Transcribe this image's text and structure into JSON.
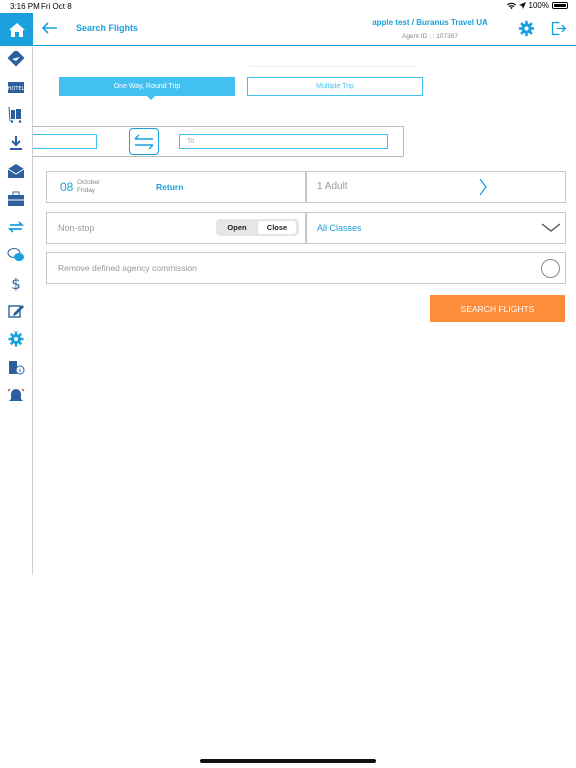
{
  "status_bar": {
    "time": "3:16 PM",
    "date": "Fri Oct 8",
    "battery": "100%"
  },
  "header": {
    "title": "Search Flights",
    "agent_name": "apple test / Buranus Travel UA",
    "agent_id": "Agent ID : : 107387"
  },
  "trip_types": {
    "one_way_round": "One Way, Round Trip",
    "multiple": "Multiple Trip",
    "selected": "One Way, Round Trip"
  },
  "route": {
    "from_value": "",
    "to_placeholder": "To"
  },
  "date": {
    "day": "08",
    "month": "October",
    "weekday": "Friday",
    "return_label": "Return"
  },
  "passengers": {
    "label": "1 Adult"
  },
  "stops": {
    "label": "Non-stop",
    "open_label": "Open",
    "close_label": "Close",
    "selected": "Close"
  },
  "cabin": {
    "label": "All Classes"
  },
  "commission": {
    "label": "Remove defined agency commission",
    "checked": false
  },
  "search_button": "SEARCH FLIGHTS",
  "sidebar": {
    "items": [
      {
        "icon": "flight-ticket-icon"
      },
      {
        "icon": "hotel-icon"
      },
      {
        "icon": "luggage-cart-icon"
      },
      {
        "icon": "download-icon"
      },
      {
        "icon": "mail-icon"
      },
      {
        "icon": "briefcase-icon"
      },
      {
        "icon": "exchange-icon"
      },
      {
        "icon": "chat-icon"
      },
      {
        "icon": "dollar-icon"
      },
      {
        "icon": "edit-icon"
      },
      {
        "icon": "settings-gear-icon"
      },
      {
        "icon": "building-info-icon"
      },
      {
        "icon": "alarm-bell-icon"
      }
    ]
  },
  "colors": {
    "accent": "#1aa0dc",
    "tab_active": "#42c1f0",
    "search_button": "#ff8c3a"
  }
}
